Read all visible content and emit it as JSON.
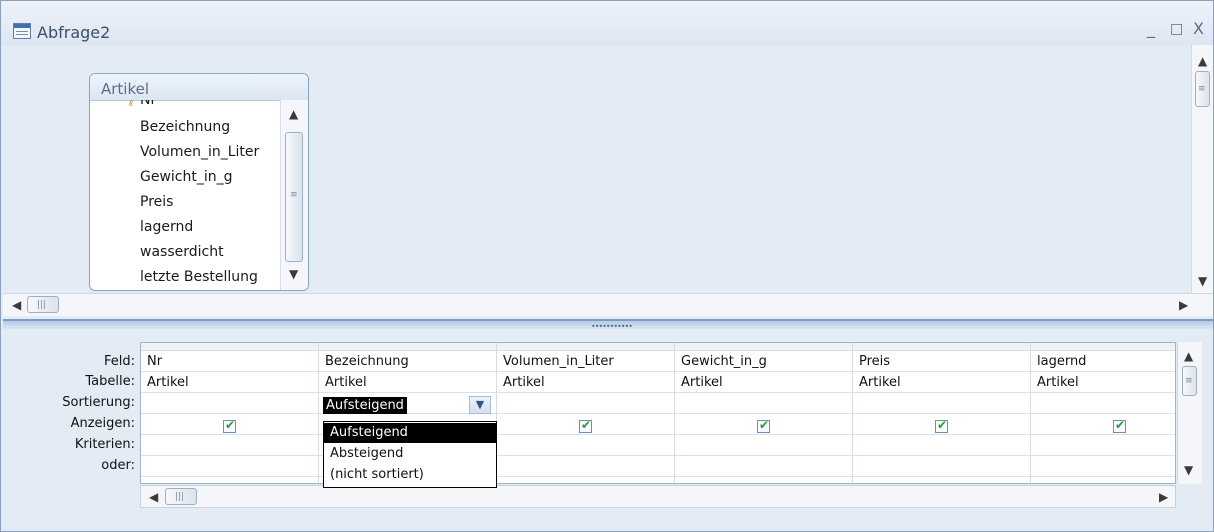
{
  "window": {
    "title": "Abfrage2",
    "minimize_glyph": "_",
    "maximize_glyph": "□",
    "close_glyph": "X"
  },
  "table": {
    "name": "Artikel",
    "fields": [
      "Nr",
      "Bezeichnung",
      "Volumen_in_Liter",
      "Gewicht_in_g",
      "Preis",
      "lagernd",
      "wasserdicht",
      "letzte Bestellung"
    ],
    "key_icon": "key-icon"
  },
  "grid": {
    "row_labels": [
      "Feld:",
      "Tabelle:",
      "Sortierung:",
      "Anzeigen:",
      "Kriterien:",
      "oder:"
    ],
    "columns": [
      {
        "feld": "Nr",
        "tabelle": "Artikel",
        "sortierung": "",
        "anzeigen": true
      },
      {
        "feld": "Bezeichnung",
        "tabelle": "Artikel",
        "sortierung": "Aufsteigend",
        "anzeigen": true
      },
      {
        "feld": "Volumen_in_Liter",
        "tabelle": "Artikel",
        "sortierung": "",
        "anzeigen": true
      },
      {
        "feld": "Gewicht_in_g",
        "tabelle": "Artikel",
        "sortierung": "",
        "anzeigen": true
      },
      {
        "feld": "Preis",
        "tabelle": "Artikel",
        "sortierung": "",
        "anzeigen": true
      },
      {
        "feld": "lagernd",
        "tabelle": "Artikel",
        "sortierung": "",
        "anzeigen": true
      }
    ]
  },
  "sort_dropdown": {
    "selected": "Aufsteigend",
    "options": [
      "Aufsteigend",
      "Absteigend",
      "(nicht sortiert)"
    ]
  },
  "colors": {
    "checkmark": "#21a121",
    "selection": "#000000",
    "pane_background": "#e3ebf5"
  }
}
